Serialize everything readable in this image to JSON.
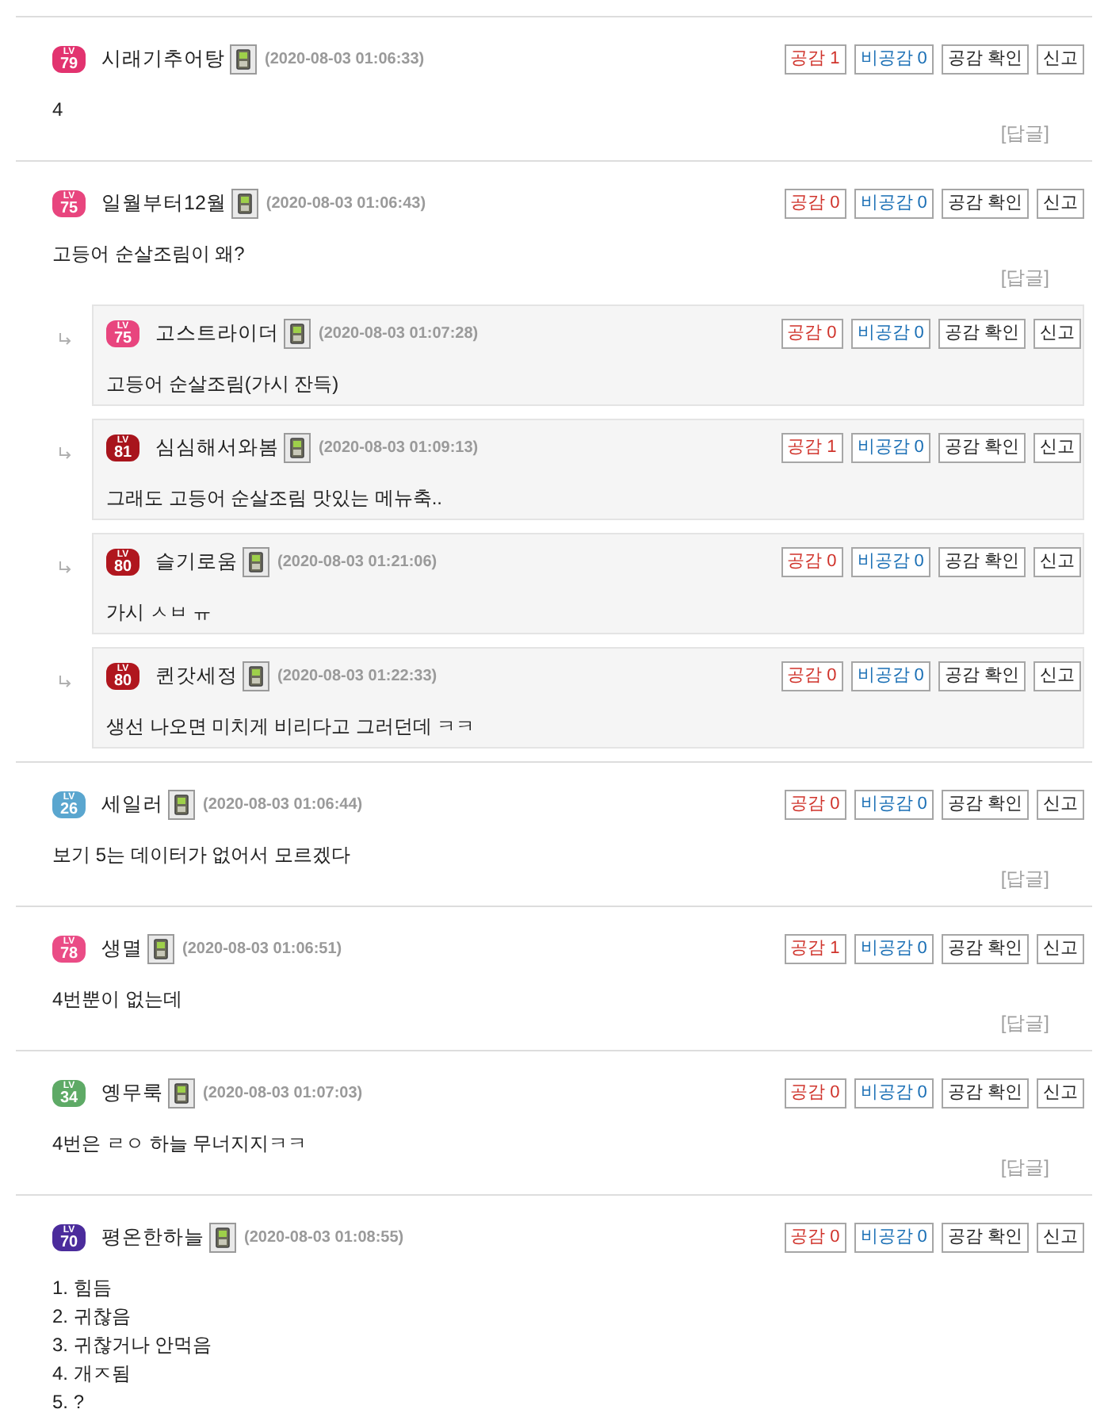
{
  "comments": [
    {
      "badge": {
        "top": "LV",
        "level": "79",
        "color": "#e2336f"
      },
      "nickname": "시래기추어탕",
      "date": "(2020-08-03 01:06:33)",
      "buttons": [
        {
          "kind": "like",
          "label": "공감 1"
        },
        {
          "kind": "dislike",
          "label": "비공감 0"
        },
        {
          "kind": "likes",
          "label": "공감 확인"
        },
        {
          "kind": "report",
          "label": "신고"
        }
      ],
      "body": "4",
      "reply_link": "[답글]"
    },
    {
      "badge": {
        "top": "LV",
        "level": "75",
        "color": "#e8457e"
      },
      "nickname": "일월부터12월",
      "date": "(2020-08-03 01:06:43)",
      "buttons": [
        {
          "kind": "like",
          "label": "공감 0"
        },
        {
          "kind": "dislike",
          "label": "비공감 0"
        },
        {
          "kind": "likes",
          "label": "공감 확인"
        },
        {
          "kind": "report",
          "label": "신고"
        }
      ],
      "body": "고등어 순살조림이 왜?",
      "reply_link": "[답글]",
      "replies": [
        {
          "badge": {
            "top": "LV",
            "level": "75",
            "color": "#e8457e"
          },
          "nickname": "고스트라이더",
          "date": "(2020-08-03 01:07:28)",
          "buttons": [
            {
              "kind": "like",
              "label": "공감 0"
            },
            {
              "kind": "dislike",
              "label": "비공감 0"
            },
            {
              "kind": "likes",
              "label": "공감 확인"
            },
            {
              "kind": "report",
              "label": "신고"
            }
          ],
          "body": "고등어 순살조림(가시 잔득)"
        },
        {
          "badge": {
            "top": "LV",
            "level": "81",
            "color": "#a8141c"
          },
          "nickname": "심심해서와봄",
          "date": "(2020-08-03 01:09:13)",
          "buttons": [
            {
              "kind": "like",
              "label": "공감 1"
            },
            {
              "kind": "dislike",
              "label": "비공감 0"
            },
            {
              "kind": "likes",
              "label": "공감 확인"
            },
            {
              "kind": "report",
              "label": "신고"
            }
          ],
          "body": "그래도 고등어 순살조림 맛있는 메뉴축.."
        },
        {
          "badge": {
            "top": "LV",
            "level": "80",
            "color": "#b0161e"
          },
          "nickname": "슬기로움",
          "date": "(2020-08-03 01:21:06)",
          "buttons": [
            {
              "kind": "like",
              "label": "공감 0"
            },
            {
              "kind": "dislike",
              "label": "비공감 0"
            },
            {
              "kind": "likes",
              "label": "공감 확인"
            },
            {
              "kind": "report",
              "label": "신고"
            }
          ],
          "body": "가시 ㅅㅂ ㅠ"
        },
        {
          "badge": {
            "top": "LV",
            "level": "80",
            "color": "#b0161e"
          },
          "nickname": "퀸갓세정",
          "date": "(2020-08-03 01:22:33)",
          "buttons": [
            {
              "kind": "like",
              "label": "공감 0"
            },
            {
              "kind": "dislike",
              "label": "비공감 0"
            },
            {
              "kind": "likes",
              "label": "공감 확인"
            },
            {
              "kind": "report",
              "label": "신고"
            }
          ],
          "body": "생선 나오면 미치게 비리다고 그러던데 ㅋㅋ"
        }
      ]
    },
    {
      "badge": {
        "top": "LV",
        "level": "26",
        "color": "#5aa6cf"
      },
      "nickname": "세일러",
      "date": "(2020-08-03 01:06:44)",
      "buttons": [
        {
          "kind": "like",
          "label": "공감 0"
        },
        {
          "kind": "dislike",
          "label": "비공감 0"
        },
        {
          "kind": "likes",
          "label": "공감 확인"
        },
        {
          "kind": "report",
          "label": "신고"
        }
      ],
      "body": "보기 5는 데이터가 없어서 모르겠다",
      "reply_link": "[답글]"
    },
    {
      "badge": {
        "top": "LV",
        "level": "78",
        "color": "#ea4c86"
      },
      "nickname": "생멸",
      "date": "(2020-08-03 01:06:51)",
      "buttons": [
        {
          "kind": "like",
          "label": "공감 1"
        },
        {
          "kind": "dislike",
          "label": "비공감 0"
        },
        {
          "kind": "likes",
          "label": "공감 확인"
        },
        {
          "kind": "report",
          "label": "신고"
        }
      ],
      "body": "4번뿐이 없는데",
      "reply_link": "[답글]"
    },
    {
      "badge": {
        "top": "LV",
        "level": "34",
        "color": "#5eaa66"
      },
      "nickname": "옝무룩",
      "date": "(2020-08-03 01:07:03)",
      "buttons": [
        {
          "kind": "like",
          "label": "공감 0"
        },
        {
          "kind": "dislike",
          "label": "비공감 0"
        },
        {
          "kind": "likes",
          "label": "공감 확인"
        },
        {
          "kind": "report",
          "label": "신고"
        }
      ],
      "body": "4번은 ㄹㅇ 하늘 무너지지ㅋㅋ",
      "reply_link": "[답글]"
    },
    {
      "badge": {
        "top": "LV",
        "level": "70",
        "color": "#4b2c9c"
      },
      "nickname": "평온한하늘",
      "date": "(2020-08-03 01:08:55)",
      "buttons": [
        {
          "kind": "like",
          "label": "공감 0"
        },
        {
          "kind": "dislike",
          "label": "비공감 0"
        },
        {
          "kind": "likes",
          "label": "공감 확인"
        },
        {
          "kind": "report",
          "label": "신고"
        }
      ],
      "body": "1. 힘듬\n2. 귀찮음\n3. 귀찮거나 안먹음\n4. 개ㅈ됨\n5. ?"
    }
  ]
}
